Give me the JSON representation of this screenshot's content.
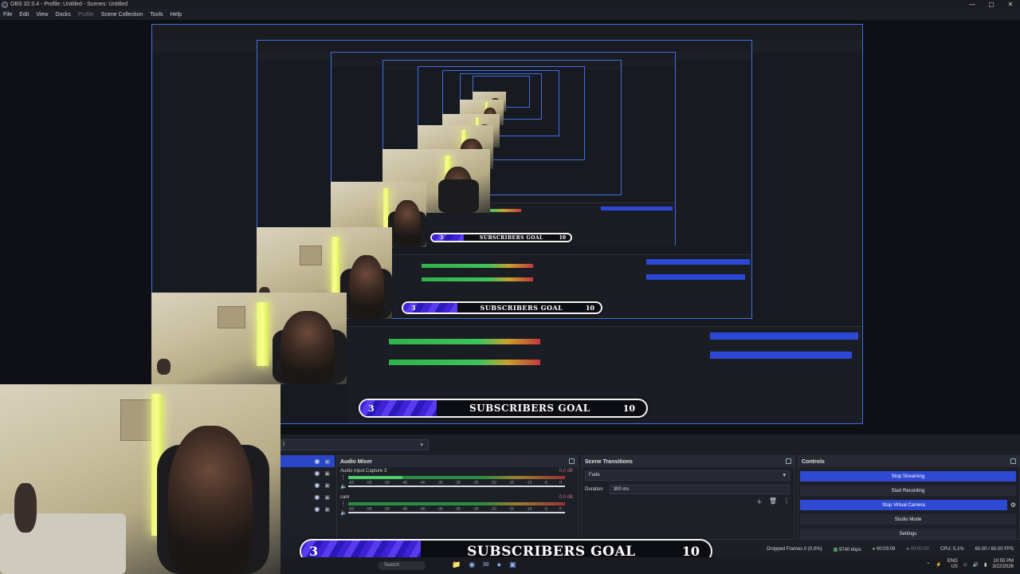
{
  "window": {
    "title": "OBS 32.0.4 - Profile: Untitled - Scenes: Untitled",
    "controls": [
      "—",
      "▢",
      "✕"
    ]
  },
  "menu": {
    "items": [
      "File",
      "Edit",
      "View",
      "Docks",
      "Profile",
      "Scene Collection",
      "Tools",
      "Help"
    ]
  },
  "sources": {
    "dropdown_text": ")"
  },
  "audio_mixer": {
    "title": "Audio Mixer",
    "tracks": [
      {
        "name": "Audio Input Capture 3",
        "db": "0.0 dB"
      },
      {
        "name": "cam",
        "db": "0.0 dB"
      }
    ],
    "ticks": [
      "-60",
      "-55",
      "-50",
      "-45",
      "-40",
      "-35",
      "-30",
      "-25",
      "-20",
      "-15",
      "-10",
      "-5",
      "0"
    ]
  },
  "scene_transitions": {
    "title": "Scene Transitions",
    "transition": "Fade",
    "duration_label": "Duration",
    "duration_value": "300 ms"
  },
  "controls": {
    "title": "Controls",
    "buttons": [
      {
        "label": "Stop Streaming",
        "active": true
      },
      {
        "label": "Start Recording",
        "active": false
      },
      {
        "label": "Stop Virtual Camera",
        "active": true
      },
      {
        "label": "Studio Mode",
        "active": false
      },
      {
        "label": "Settings",
        "active": false
      }
    ]
  },
  "goal": {
    "current": "3",
    "label": "SUBSCRIBERS GOAL",
    "target": "10"
  },
  "status": {
    "dropped": "Dropped Frames 0 (0.0%)",
    "bitrate": "9740 kbps",
    "stream_time": "00:03:09",
    "rec_time": "00:00:00",
    "cpu": "CPU: 5.1%",
    "fps": "60.00 / 60.00 FPS"
  },
  "taskbar": {
    "search": "Search",
    "lang": "ENG",
    "region": "US",
    "time": "10:55 PM",
    "date": "3/22/2026"
  }
}
